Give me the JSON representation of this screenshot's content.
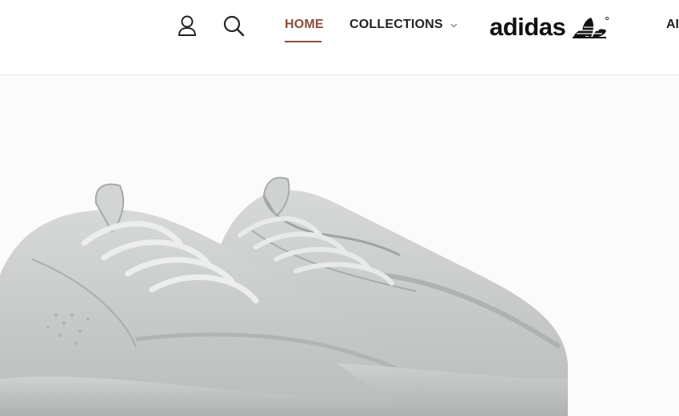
{
  "header": {
    "nav": {
      "home": "HOME",
      "collections": "COLLECTIONS",
      "cut": "AI"
    },
    "logo": "adidas",
    "icons": {
      "account": "user-icon",
      "search": "search-icon",
      "dropdown": "chevron-down-icon",
      "logo_mark": "trefoil-logo"
    }
  },
  "hero": {
    "image": "grey-sneakers-product-image"
  },
  "colors": {
    "active_nav": "#8a4a3a",
    "text": "#222222",
    "shoe": "#c9ccca"
  }
}
